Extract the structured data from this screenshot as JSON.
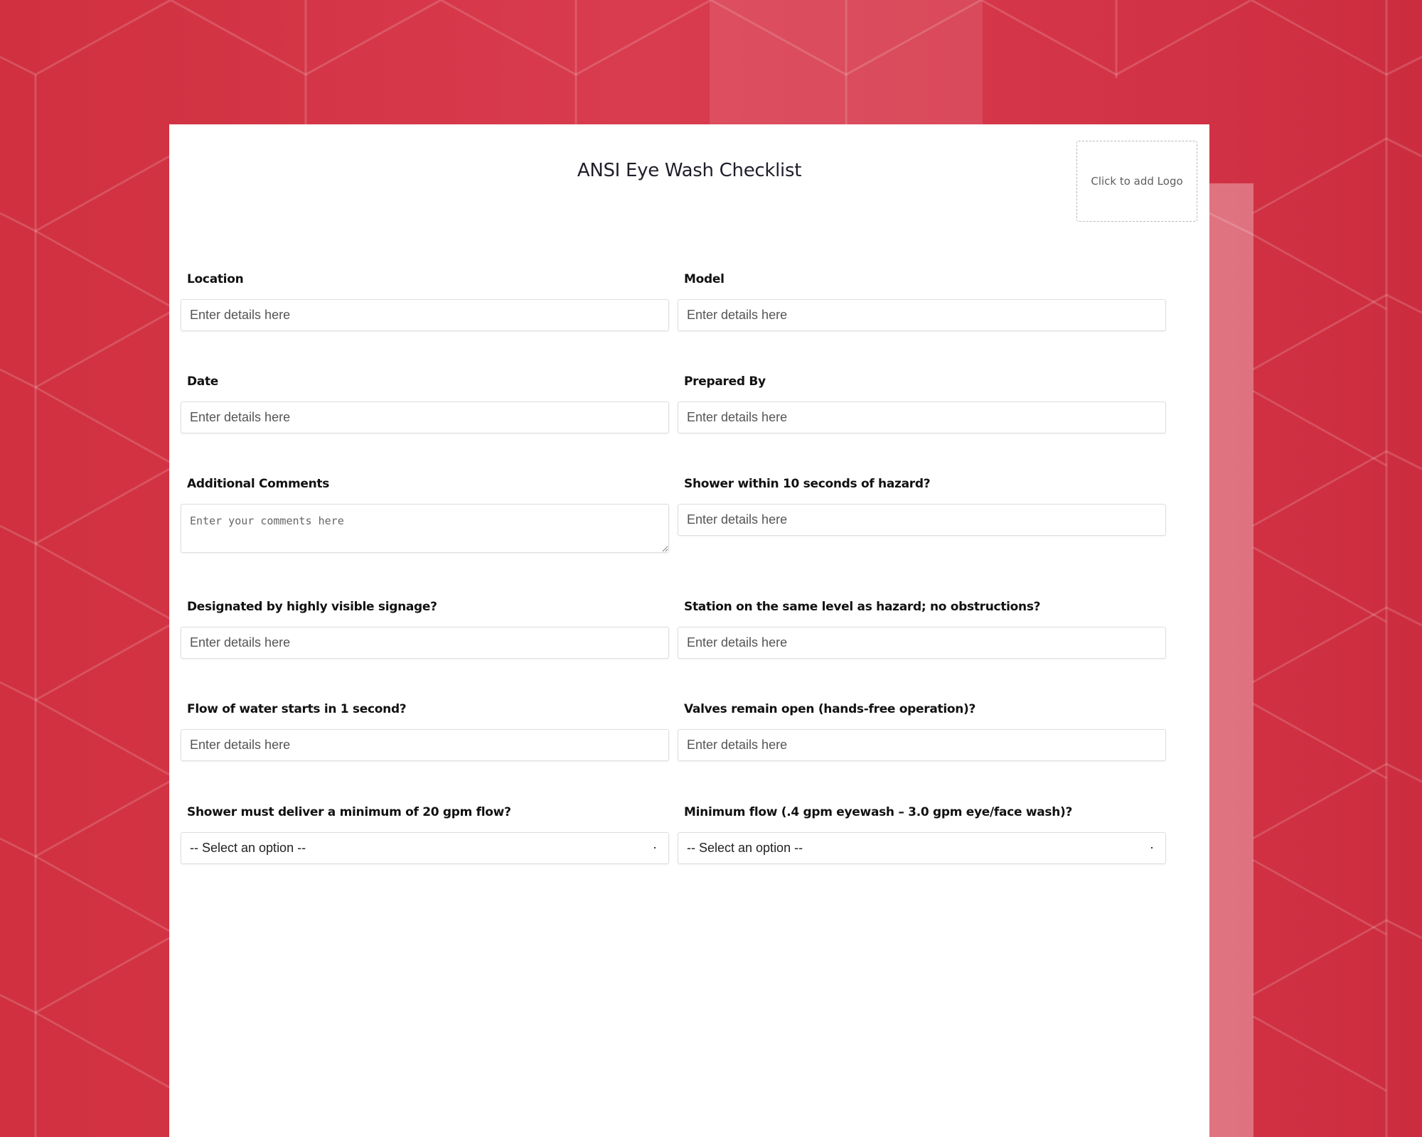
{
  "colors": {
    "background": "#d43448",
    "card": "#ffffff",
    "label": "#111111",
    "placeholder": "#555555"
  },
  "form": {
    "title": "ANSI Eye Wash Checklist",
    "logo_placeholder": "Click to add Logo",
    "fields": [
      {
        "label": "Location",
        "type": "text",
        "placeholder": "Enter details here",
        "value": ""
      },
      {
        "label": "Model",
        "type": "text",
        "placeholder": "Enter details here",
        "value": ""
      },
      {
        "label": "Date",
        "type": "text",
        "placeholder": "Enter details here",
        "value": ""
      },
      {
        "label": "Prepared By",
        "type": "text",
        "placeholder": "Enter details here",
        "value": ""
      },
      {
        "label": "Additional Comments",
        "type": "textarea",
        "placeholder": "Enter your comments here",
        "value": ""
      },
      {
        "label": "Shower within 10 seconds of hazard?",
        "type": "text",
        "placeholder": "Enter details here",
        "value": ""
      },
      {
        "label": "Designated by highly visible signage?",
        "type": "text",
        "placeholder": "Enter details here",
        "value": ""
      },
      {
        "label": "Station on the same level as hazard; no obstructions?",
        "type": "text",
        "placeholder": "Enter details here",
        "value": ""
      },
      {
        "label": "Flow of water starts in 1 second?",
        "type": "text",
        "placeholder": "Enter details here",
        "value": ""
      },
      {
        "label": "Valves remain open (hands-free operation)?",
        "type": "text",
        "placeholder": "Enter details here",
        "value": ""
      },
      {
        "label": "Shower must deliver a minimum of 20 gpm flow?",
        "type": "select",
        "selected": "-- Select an option --"
      },
      {
        "label": "Minimum flow (.4 gpm eyewash – 3.0 gpm eye/face wash)?",
        "type": "select",
        "selected": "-- Select an option --"
      }
    ]
  }
}
